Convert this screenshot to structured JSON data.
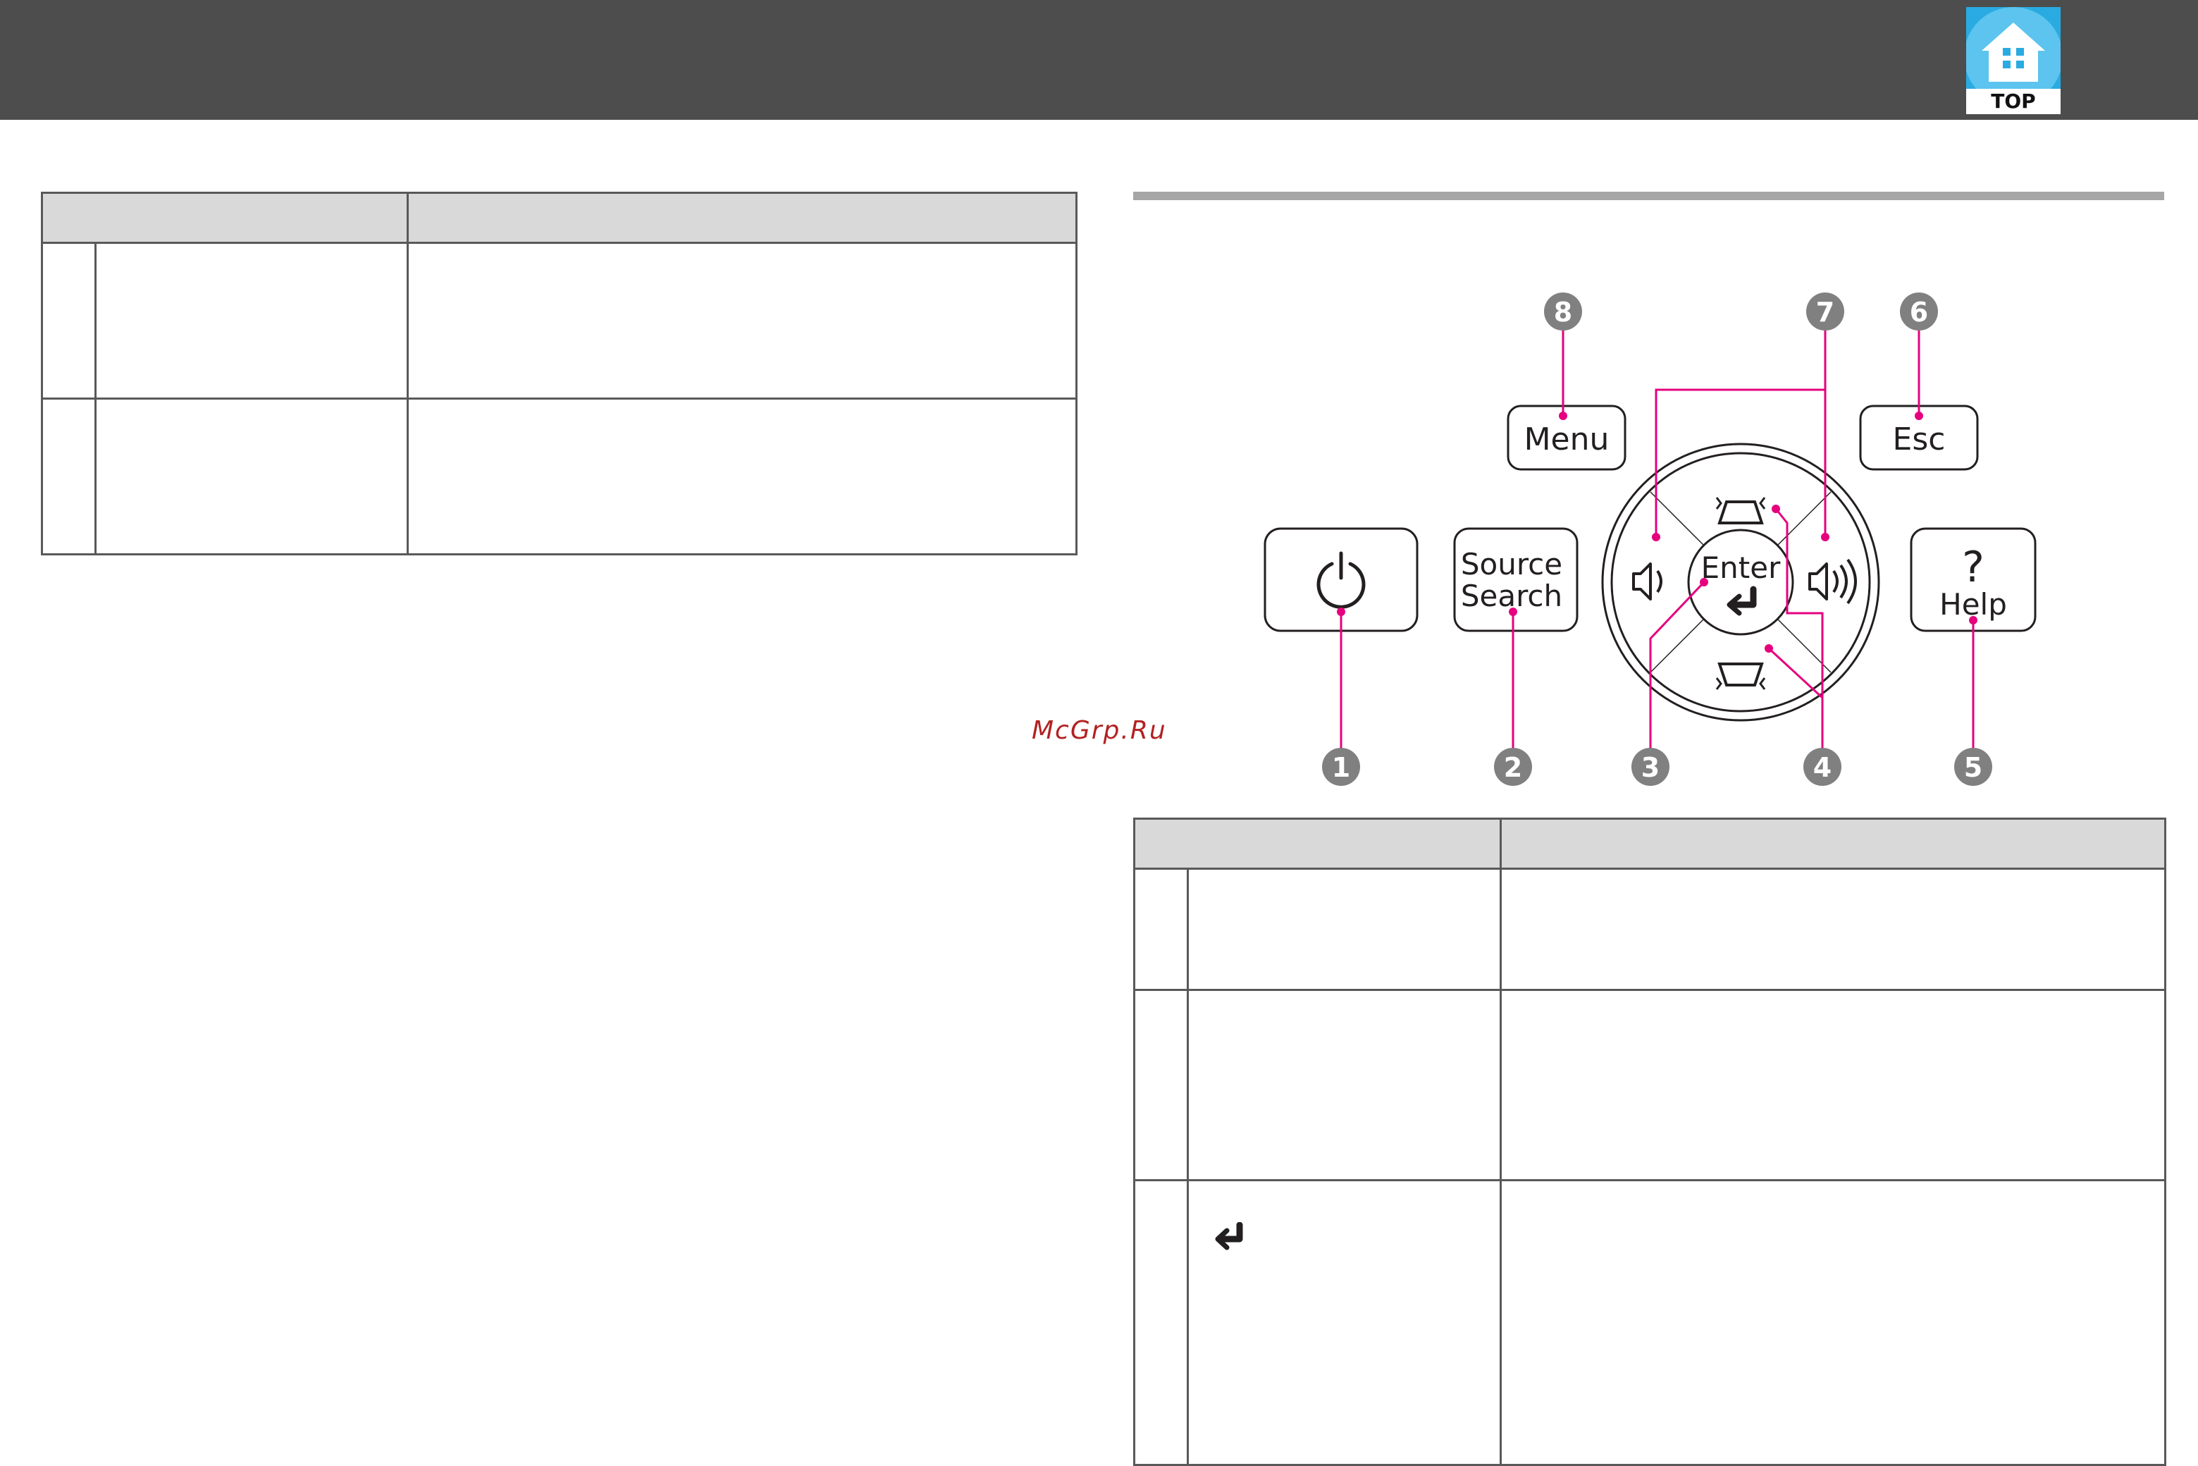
{
  "header": {
    "top_logo_label": "TOP",
    "colors": {
      "bar": "#4d4d4d",
      "logo_blue": "#29abe2"
    }
  },
  "watermark": {
    "text": "McGrp.Ru"
  },
  "control_panel": {
    "callouts": [
      "1",
      "2",
      "3",
      "4",
      "5",
      "6",
      "7",
      "8"
    ],
    "buttons": {
      "menu": "Menu",
      "esc": "Esc",
      "source": "Source",
      "search": "Search",
      "enter": "Enter",
      "help": "Help",
      "help_glyph": "?"
    },
    "icons": [
      "power-icon",
      "volume-down-icon",
      "volume-up-icon",
      "keystone-up-icon",
      "keystone-down-icon",
      "enter-arrow-icon"
    ],
    "colors": {
      "callout_line": "#e6007e",
      "callout_circle": "#808080"
    }
  },
  "right_table": {
    "row3_icon": "enter-arrow-icon"
  }
}
